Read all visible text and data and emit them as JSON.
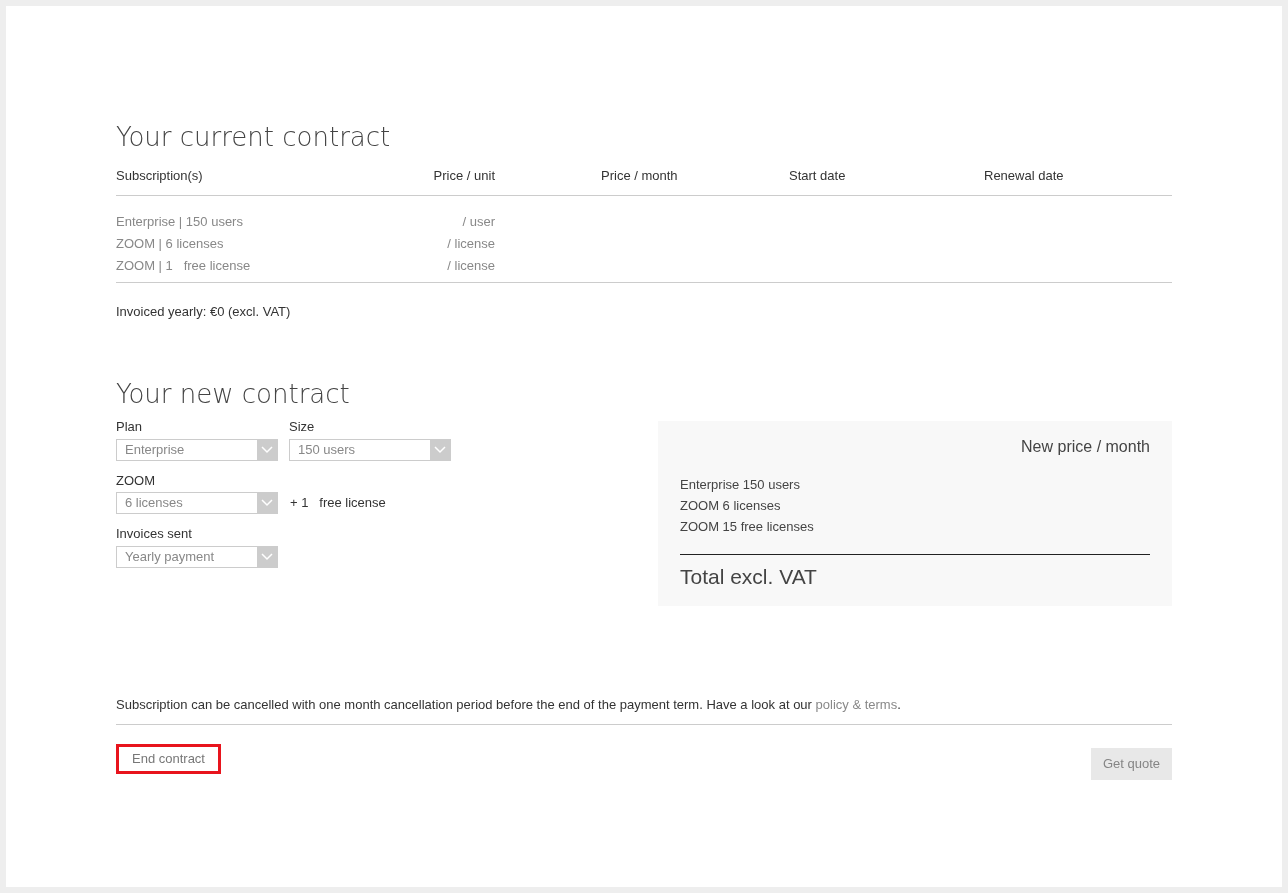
{
  "current_contract": {
    "title": "Your current contract",
    "columns": [
      "Subscription(s)",
      "Price / unit",
      "Price / month",
      "Start date",
      "Renewal date"
    ],
    "rows": [
      {
        "subscription": "Enterprise | 150 users",
        "price_unit": "/ user"
      },
      {
        "subscription": "ZOOM | 6 licenses",
        "price_unit": "/ license"
      },
      {
        "subscription": "ZOOM | 1   free license",
        "price_unit": "/ license"
      }
    ],
    "invoiced": "Invoiced yearly: €0 (excl. VAT)"
  },
  "new_contract": {
    "title": "Your new contract",
    "fields": [
      {
        "label": "Plan",
        "value": "Enterprise"
      },
      {
        "label": "Size",
        "value": "150 users"
      },
      {
        "label": "ZOOM",
        "value": "6 licenses",
        "note": "+ 1   free license"
      },
      {
        "label": "Invoices sent",
        "value": "Yearly payment"
      }
    ],
    "summary": {
      "heading": "New price / month",
      "lines": [
        "Enterprise 150 users",
        "ZOOM 6 licenses",
        "ZOOM 15 free licenses"
      ],
      "total": "Total excl. VAT"
    }
  },
  "footer": {
    "notice": "Subscription can be cancelled with one month cancellation period before the end of the payment term. Have a look at our ",
    "link": "policy & terms",
    "after_link": ".",
    "end_button": {
      "label": "End contract",
      "focused": true
    },
    "quote_button": {
      "label": "Get quote",
      "disabled": true
    }
  }
}
